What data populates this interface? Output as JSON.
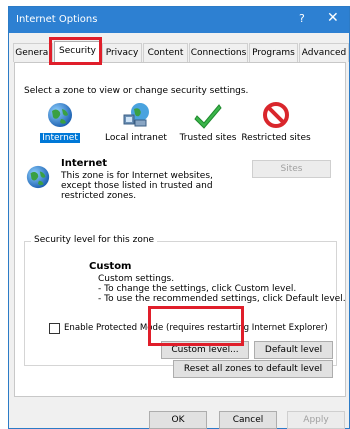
{
  "window": {
    "title": "Internet Options",
    "help": "?",
    "close": "✕"
  },
  "tabs": [
    {
      "label": "General"
    },
    {
      "label": "Security"
    },
    {
      "label": "Privacy"
    },
    {
      "label": "Content"
    },
    {
      "label": "Connections"
    },
    {
      "label": "Programs"
    },
    {
      "label": "Advanced"
    }
  ],
  "security": {
    "instruction": "Select a zone to view or change security settings.",
    "zones": [
      {
        "label": "Internet",
        "icon": "globe-icon"
      },
      {
        "label": "Local intranet",
        "icon": "network-icon"
      },
      {
        "label": "Trusted sites",
        "icon": "checkmark-icon"
      },
      {
        "label": "Restricted sites",
        "icon": "restricted-icon"
      }
    ],
    "zone_title": "Internet",
    "zone_desc_1": "This zone is for Internet websites,",
    "zone_desc_2": "except those listed in trusted and",
    "zone_desc_3": "restricted zones.",
    "sites_button": "Sites",
    "level_group": "Security level for this zone",
    "level_title": "Custom",
    "level_line_1": "Custom settings.",
    "level_line_2": "- To change the settings, click Custom level.",
    "level_line_3": "- To use the recommended settings, click Default level.",
    "protected_mode": "Enable Protected Mode (requires restarting Internet Explorer)",
    "custom_level_button": "Custom level...",
    "default_level_button": "Default level",
    "reset_button": "Reset all zones to default level"
  },
  "footer": {
    "ok": "OK",
    "cancel": "Cancel",
    "apply": "Apply"
  },
  "colors": {
    "titlebar": "#2d80d2",
    "highlight": "#e01e2a",
    "selection": "#0078d7"
  }
}
